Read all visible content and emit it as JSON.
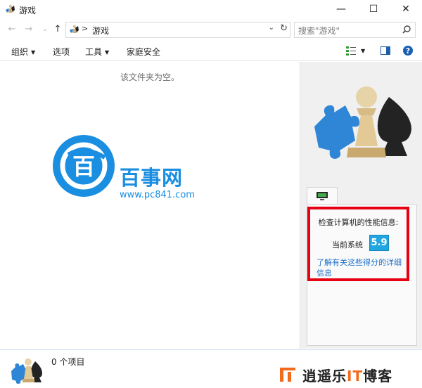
{
  "window": {
    "title": "游戏",
    "minimize_glyph": "—",
    "maximize_glyph": "☐",
    "close_glyph": "✕"
  },
  "nav": {
    "back_glyph": "←",
    "forward_glyph": "→",
    "recent_glyph": "⌄",
    "up_glyph": "↑",
    "address_separator": ">",
    "address_text": "游戏",
    "dropdown_glyph": "⌄",
    "refresh_glyph": "↻",
    "search_placeholder": "搜索\"游戏\""
  },
  "toolbar": {
    "organize": "组织",
    "options": "选项",
    "tools": "工具",
    "family_safety": "家庭安全"
  },
  "content": {
    "empty_message": "该文件夹为空。"
  },
  "watermark": {
    "logo_char": "百",
    "title": "百事网",
    "url": "www.pc841.com"
  },
  "preview": {
    "performance_title": "检查计算机的性能信息:",
    "current_system_label": "当前系统",
    "score": "5.9",
    "details_link": "了解有关这些得分的详细信息"
  },
  "status": {
    "item_count": "0 个项目"
  },
  "brand": {
    "prefix": "逍遥乐",
    "accent": "IT",
    "suffix": "博客"
  },
  "colors": {
    "accent_blue": "#1a8ee0",
    "score_blue": "#22a6e0",
    "highlight_red": "#e60012",
    "link_blue": "#1e6fc9",
    "brand_orange": "#f26a1b"
  },
  "icons": [
    "games-folder-icon",
    "back-arrow-icon",
    "forward-arrow-icon",
    "up-arrow-icon",
    "search-icon",
    "view-options-icon",
    "preview-pane-icon",
    "help-icon",
    "chess-puzzle-icon",
    "monitor-icon"
  ]
}
